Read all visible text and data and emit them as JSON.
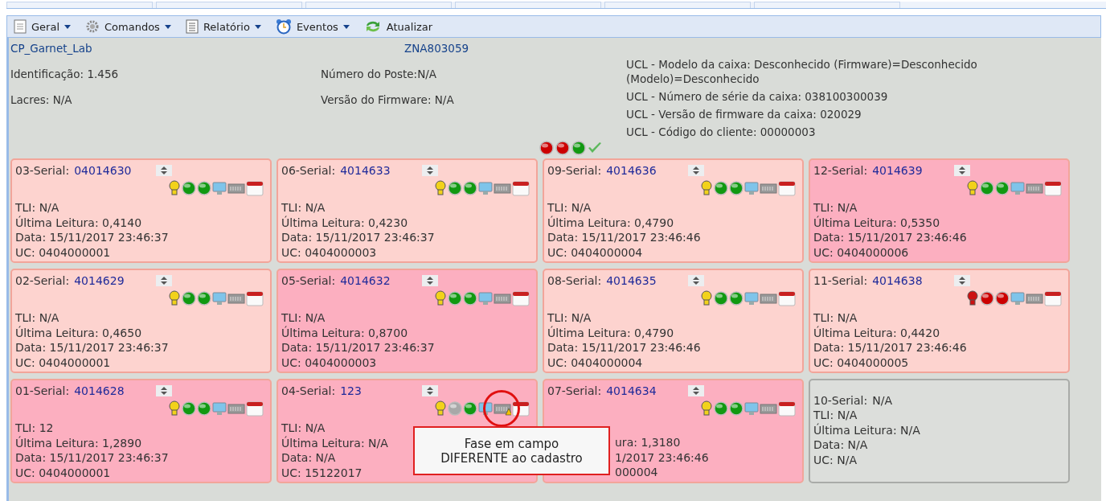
{
  "toolbar": [
    {
      "label": "Geral",
      "menu": true
    },
    {
      "label": "Comandos",
      "menu": true
    },
    {
      "label": "Relatório",
      "menu": true
    },
    {
      "label": "Eventos",
      "menu": true
    },
    {
      "label": "Atualizar",
      "menu": false
    }
  ],
  "header": {
    "name": "CP_Garnet_Lab",
    "code": "ZNA803059",
    "left": [
      "Identificação: 1.456",
      "Lacres: N/A"
    ],
    "middle": [
      "Número do Poste:N/A",
      "Versão do Firmware: N/A"
    ],
    "right": [
      "UCL - Modelo da caixa: Desconhecido (Firmware)=Desconhecido (Modelo)=Desconhecido",
      "UCL - Número de série da caixa: 038100300039",
      "UCL - Versão de firmware da caixa: 020029",
      "UCL - Código do cliente: 00000003"
    ]
  },
  "status": [
    {
      "kind": "dot",
      "color": "#cc0000"
    },
    {
      "kind": "dot",
      "color": "#cc0000"
    },
    {
      "kind": "dot",
      "color": "#119911"
    },
    {
      "kind": "check"
    }
  ],
  "cards": [
    {
      "kind": "normal",
      "color": "#fdd3cf",
      "label": "03-Serial:",
      "serial": "04014630",
      "lamp": {
        "color": "#f2d21a"
      },
      "dots": [
        {
          "color": "#119911"
        },
        {
          "color": "#119911"
        }
      ],
      "warning": false,
      "lines": [
        "TLI: N/A",
        "Última Leitura: 0,4140",
        "Data: 15/11/2017 23:46:37",
        "UC: 0404000001"
      ]
    },
    {
      "kind": "normal",
      "color": "#fdd3cf",
      "label": "06-Serial:",
      "serial": "4014633",
      "lamp": {
        "color": "#f2d21a"
      },
      "dots": [
        {
          "color": "#119911"
        },
        {
          "color": "#119911"
        }
      ],
      "warning": false,
      "lines": [
        "TLI: N/A",
        "Última Leitura: 0,4230",
        "Data: 15/11/2017 23:46:37",
        "UC: 0404000003"
      ]
    },
    {
      "kind": "normal",
      "color": "#fdd3cf",
      "label": "09-Serial:",
      "serial": "4014636",
      "lamp": {
        "color": "#f2d21a"
      },
      "dots": [
        {
          "color": "#119911"
        },
        {
          "color": "#119911"
        }
      ],
      "warning": false,
      "lines": [
        "TLI: N/A",
        "Última Leitura: 0,4790",
        "Data: 15/11/2017 23:46:46",
        "UC: 0404000004"
      ]
    },
    {
      "kind": "normal",
      "color": "#fcafc0",
      "label": "12-Serial:",
      "serial": "4014639",
      "lamp": {
        "color": "#f2d21a"
      },
      "dots": [
        {
          "color": "#119911"
        },
        {
          "color": "#119911"
        }
      ],
      "warning": false,
      "lines": [
        "TLI: N/A",
        "Última Leitura: 0,5350",
        "Data: 15/11/2017 23:46:46",
        "UC: 0404000006"
      ]
    },
    {
      "kind": "normal",
      "color": "#fdd3cf",
      "label": "02-Serial:",
      "serial": "4014629",
      "lamp": {
        "color": "#f2d21a"
      },
      "dots": [
        {
          "color": "#119911"
        },
        {
          "color": "#119911"
        }
      ],
      "warning": false,
      "lines": [
        "TLI: N/A",
        "Última Leitura: 0,4650",
        "Data: 15/11/2017 23:46:37",
        "UC: 0404000001"
      ]
    },
    {
      "kind": "normal",
      "color": "#fcafc0",
      "label": "05-Serial:",
      "serial": "4014632",
      "lamp": {
        "color": "#f2d21a"
      },
      "dots": [
        {
          "color": "#119911"
        },
        {
          "color": "#119911"
        }
      ],
      "warning": false,
      "lines": [
        "TLI: N/A",
        "Última Leitura: 0,8700",
        "Data: 15/11/2017 23:46:37",
        "UC: 0404000003"
      ]
    },
    {
      "kind": "normal",
      "color": "#fdd3cf",
      "label": "08-Serial:",
      "serial": "4014635",
      "lamp": {
        "color": "#f2d21a"
      },
      "dots": [
        {
          "color": "#119911"
        },
        {
          "color": "#119911"
        }
      ],
      "warning": false,
      "lines": [
        "TLI: N/A",
        "Última Leitura: 0,4790",
        "Data: 15/11/2017 23:46:46",
        "UC: 0404000004"
      ]
    },
    {
      "kind": "normal",
      "color": "#fdd3cf",
      "label": "11-Serial:",
      "serial": "4014638",
      "lamp": {
        "color": "#cc1111"
      },
      "dots": [
        {
          "color": "#cc0000"
        },
        {
          "color": "#cc0000"
        }
      ],
      "warning": false,
      "lines": [
        "TLI: N/A",
        "Última Leitura: 0,4420",
        "Data: 15/11/2017 23:46:46",
        "UC: 0404000005"
      ]
    },
    {
      "kind": "normal",
      "color": "#fcafc0",
      "label": "01-Serial:",
      "serial": "4014628",
      "lamp": {
        "color": "#f2d21a"
      },
      "dots": [
        {
          "color": "#119911"
        },
        {
          "color": "#119911"
        }
      ],
      "warning": false,
      "lines": [
        "TLI: 12",
        "Última Leitura: 1,2890",
        "Data: 15/11/2017 23:46:37",
        "UC: 0404000001"
      ]
    },
    {
      "kind": "normal",
      "color": "#fcafc0",
      "label": "04-Serial:",
      "serial": "123",
      "lamp": {
        "color": "#f2d21a"
      },
      "dots": [
        {
          "color": "#a8a8a8"
        },
        {
          "color": "#119911"
        }
      ],
      "warning": true,
      "lines": [
        "TLI: N/A",
        "Última Leitura: N/A",
        "Data: N/A",
        "UC: 15122017"
      ]
    },
    {
      "kind": "covered",
      "color": "#fcafc0",
      "label": "07-Serial:",
      "serial": "4014634",
      "lamp": {
        "color": "#f2d21a"
      },
      "dots": [
        {
          "color": "#119911"
        },
        {
          "color": "#119911"
        }
      ],
      "warning": false,
      "lines": [
        "ura: 1,3180",
        "1/2017 23:46:46",
        "000004"
      ]
    },
    {
      "kind": "empty",
      "color": "#dcdedb",
      "label": "10-Serial:",
      "serial": "N/A",
      "lines": [
        "TLI: N/A",
        "Última Leitura: N/A",
        "Data: N/A",
        "UC: N/A"
      ]
    }
  ],
  "tooltip": {
    "lines": [
      "Fase em campo",
      "DIFERENTE ao cadastro"
    ]
  }
}
